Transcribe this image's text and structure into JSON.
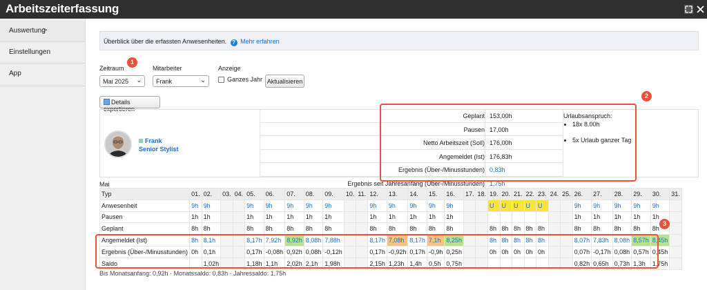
{
  "app": {
    "title": "Arbeitszeiterfassung"
  },
  "sidebar": {
    "items": [
      {
        "label": "Auswertung",
        "chevron": ">"
      },
      {
        "label": "Einstellungen"
      },
      {
        "label": "App"
      }
    ]
  },
  "info": {
    "text": "Überblick über die erfassten Anwesenheiten.",
    "link": "Mehr erfahren"
  },
  "filters": {
    "zeitraum_label": "Zeitraum",
    "zeitraum_value": "Mai 2025",
    "mitarbeiter_label": "Mitarbeiter",
    "mitarbeiter_value": "Frank",
    "anzeige_label": "Anzeige",
    "ganzes_jahr_label": "Ganzes Jahr",
    "ganzes_jahr_checked": false,
    "aktualisieren": "Aktualisieren"
  },
  "export_button": "Details exportieren",
  "badges": [
    "1",
    "2",
    "3"
  ],
  "employee": {
    "name": "Frank",
    "role": "Senior Stylist"
  },
  "summary": [
    {
      "label": "Geplant",
      "value": "153,00h",
      "blue": false
    },
    {
      "label": "Pausen",
      "value": "17,00h",
      "blue": false
    },
    {
      "label": "Netto Arbeitszeit (Soll)",
      "value": "176,00h",
      "blue": false
    },
    {
      "label": "Angemeldet (Ist)",
      "value": "176,83h",
      "blue": false
    },
    {
      "label": "Ergebnis (Über-/Minusstunden)",
      "value": "0,83h",
      "blue": true
    },
    {
      "label": "Ergebnis seit Jahresanfang (Über-/Minusstunden)",
      "value": "1,75h",
      "blue": true
    }
  ],
  "urlaub": {
    "title": "Urlaubsanspruch:",
    "items": [
      "18x 8.00h",
      "5x Urlaub ganzer Tag"
    ]
  },
  "month": "Mai",
  "table": {
    "type_header": "Typ",
    "days": [
      "01.",
      "02.",
      "03.",
      "04.",
      "05.",
      "06.",
      "07.",
      "08.",
      "09.",
      "10.",
      "11.",
      "12.",
      "13.",
      "14.",
      "15.",
      "16.",
      "17.",
      "18.",
      "19.",
      "20.",
      "21.",
      "22.",
      "23.",
      "24.",
      "25.",
      "26.",
      "27.",
      "28.",
      "29.",
      "30.",
      "31."
    ],
    "weekend_idx": [
      2,
      3,
      9,
      10,
      16,
      17,
      23,
      24,
      30
    ],
    "rows": [
      {
        "label": "Anwesenheit",
        "blue": true,
        "cells": [
          "9h",
          "9h",
          "",
          "",
          "9h",
          "9h",
          "9h",
          "9h",
          "9h",
          "",
          "",
          "9h",
          "9h",
          "9h",
          "9h",
          "9h",
          "",
          "",
          "U",
          "U",
          "U",
          "U",
          "U",
          "",
          "",
          "9h",
          "9h",
          "9h",
          "9h",
          "9h",
          ""
        ]
      },
      {
        "label": "Pausen",
        "cells": [
          "1h",
          "1h",
          "",
          "",
          "1h",
          "1h",
          "1h",
          "1h",
          "1h",
          "",
          "",
          "1h",
          "1h",
          "1h",
          "1h",
          "1h",
          "",
          "",
          "",
          "",
          "",
          "",
          "",
          "",
          "",
          "1h",
          "1h",
          "1h",
          "1h",
          "1h",
          ""
        ]
      },
      {
        "label": "Geplant",
        "cells": [
          "8h",
          "8h",
          "",
          "",
          "8h",
          "8h",
          "8h",
          "8h",
          "8h",
          "",
          "",
          "8h",
          "8h",
          "8h",
          "8h",
          "8h",
          "",
          "",
          "8h",
          "8h",
          "8h",
          "8h",
          "8h",
          "",
          "",
          "8h",
          "8h",
          "8h",
          "8h",
          "8h",
          ""
        ]
      },
      {
        "label": "Angemeldet (Ist)",
        "blue": true,
        "cells": [
          "8h",
          "8,1h",
          "",
          "",
          "8,17h",
          "7,92h",
          "8,92h",
          "8,08h",
          "7,88h",
          "",
          "",
          "8,17h",
          "7,08h",
          "8,17h",
          "7,1h",
          "8,25h",
          "",
          "",
          "8h",
          "8h",
          "8h",
          "8h",
          "8h",
          "",
          "",
          "8,07h",
          "7,83h",
          "8,08h",
          "8,57h",
          "8,45h",
          ""
        ]
      },
      {
        "label": "Ergebnis (Über-/Minusstunden)",
        "cells": [
          "0h",
          "0,1h",
          "",
          "",
          "0,17h",
          "-0,08h",
          "0,92h",
          "0,08h",
          "-0,12h",
          "",
          "",
          "0,17h",
          "-0,92h",
          "0,17h",
          "-0,9h",
          "0,25h",
          "",
          "",
          "0h",
          "0h",
          "0h",
          "0h",
          "0h",
          "",
          "",
          "0,07h",
          "-0,17h",
          "0,08h",
          "0,57h",
          "0,45h",
          ""
        ]
      },
      {
        "label": "Saldo",
        "cells": [
          "",
          "1,02h",
          "",
          "",
          "1,18h",
          "1,1h",
          "2,02h",
          "2,1h",
          "1,98h",
          "",
          "",
          "2,15h",
          "1,23h",
          "1,4h",
          "0,5h",
          "0,75h",
          "",
          "",
          "",
          "",
          "",
          "",
          "",
          "",
          "",
          "0,82h",
          "0,65h",
          "0,73h",
          "1,3h",
          "1,75h",
          ""
        ]
      }
    ],
    "highlight": {
      "yellow": {
        "row": 0,
        "days": [
          18,
          19,
          20,
          21,
          22
        ]
      },
      "green": {
        "row": 3,
        "days": [
          6,
          15,
          28,
          29
        ]
      },
      "orange": {
        "row": 3,
        "days": [
          12,
          14
        ]
      }
    }
  },
  "footer": "Bis Monatsanfang: 0,92h · Monatssaldo: 0,83h · Jahressaldo: 1,75h",
  "colors": {
    "accent": "#1b6fc7",
    "badge": "#e8513a",
    "yellow": "#fbe43a",
    "green": "#b5e48a",
    "orange": "#f6c37b"
  }
}
